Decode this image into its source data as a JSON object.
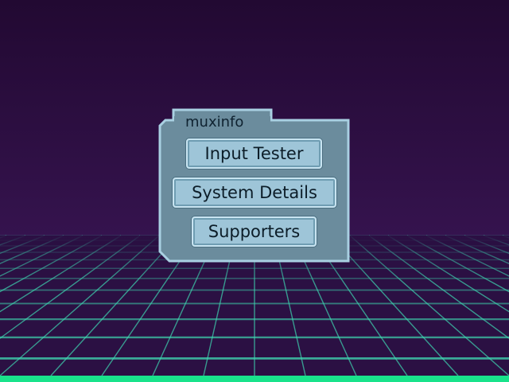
{
  "theme": {
    "background_top": "#230a33",
    "background_horizon": "#3b1756",
    "grid_color": "#3fd7b0",
    "floor_strip": "#19e38b",
    "panel_fill": "#6b8c9d",
    "panel_border": "#a9d0e2",
    "button_fill": "#9ec5d8"
  },
  "panel": {
    "title": "muxinfo"
  },
  "menu": {
    "items": [
      {
        "label": "Input Tester"
      },
      {
        "label": "System Details"
      },
      {
        "label": "Supporters"
      }
    ]
  }
}
